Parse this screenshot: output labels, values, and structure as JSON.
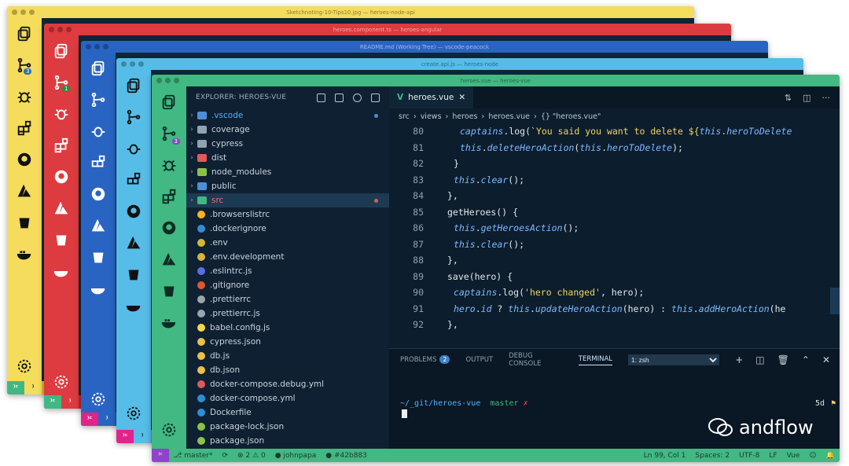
{
  "windows": [
    {
      "title": "Sketchnoting-10-Tips10.jpg — heroes-node-api",
      "color": "#f5dc5c",
      "status_color": "#d6be2e"
    },
    {
      "title": "heroes.component.ts — heroes-angular",
      "color": "#dd3b3f",
      "status_color": "#b22c30"
    },
    {
      "title": "README.md (Working Tree) — vscode-peacock",
      "color": "#2a64c2",
      "status_color": "#1d4f9e"
    },
    {
      "title": "create.api.js — heroes-node",
      "color": "#55bde8",
      "status_color": "#3ba2cf"
    },
    {
      "title": "heroes.vue — heroes-vue",
      "color": "#42b883",
      "status_color": "#2f9a6b"
    }
  ],
  "front": {
    "explorer_title": "EXPLORER: HEROES-VUE",
    "tree": [
      {
        "name": ".vscode",
        "folder": true,
        "color": "#4d8ed8",
        "mod": "#4d8ed8",
        "name_color": "#4db2ff"
      },
      {
        "name": "coverage",
        "folder": true,
        "color": "#8fa3b0"
      },
      {
        "name": "cypress",
        "folder": true,
        "color": "#8fa3b0"
      },
      {
        "name": "dist",
        "folder": true,
        "color": "#e05a5a"
      },
      {
        "name": "node_modules",
        "folder": true,
        "color": "#8bc34a"
      },
      {
        "name": "public",
        "folder": true,
        "color": "#4d8ed8"
      },
      {
        "name": "src",
        "folder": true,
        "color": "#41b883",
        "sel": true,
        "mod": "#e05a5a",
        "name_color": "#e07070"
      },
      {
        "name": ".browserslistrc",
        "folder": false,
        "color": "#f5b324"
      },
      {
        "name": ".dockerignore",
        "folder": false,
        "color": "#2f8ed6"
      },
      {
        "name": ".env",
        "folder": false,
        "color": "#d6b53b"
      },
      {
        "name": ".env.development",
        "folder": false,
        "color": "#d6b53b"
      },
      {
        "name": ".eslintrc.js",
        "folder": false,
        "color": "#5b6ee0"
      },
      {
        "name": ".gitignore",
        "folder": false,
        "color": "#e0572e"
      },
      {
        "name": ".prettierrc",
        "folder": false,
        "color": "#9aa5ad"
      },
      {
        "name": ".prettierrc.js",
        "folder": false,
        "color": "#9aa5ad"
      },
      {
        "name": "babel.config.js",
        "folder": false,
        "color": "#f5d742"
      },
      {
        "name": "cypress.json",
        "folder": false,
        "color": "#e8c04a"
      },
      {
        "name": "db.js",
        "folder": false,
        "color": "#e8c04a"
      },
      {
        "name": "db.json",
        "folder": false,
        "color": "#e8c04a"
      },
      {
        "name": "docker-compose.debug.yml",
        "folder": false,
        "color": "#e05a5a"
      },
      {
        "name": "docker-compose.yml",
        "folder": false,
        "color": "#2f8ed6"
      },
      {
        "name": "Dockerfile",
        "folder": false,
        "color": "#2f8ed6"
      },
      {
        "name": "package-lock.json",
        "folder": false,
        "color": "#8bc34a"
      },
      {
        "name": "package.json",
        "folder": false,
        "color": "#8bc34a"
      }
    ],
    "tab_label": "heroes.vue",
    "breadcrumb": [
      "src",
      "views",
      "heroes",
      "heroes.vue",
      "{} \"heroes.vue\""
    ],
    "code_lines": [
      {
        "n": "80",
        "indent": 4,
        "parts": [
          [
            "kw",
            "captains"
          ],
          [
            "fn",
            ".log("
          ],
          [
            "str",
            "`You said you want to delete ${"
          ],
          [
            "kw",
            "this"
          ],
          [
            "str",
            "."
          ],
          [
            "kw",
            "heroToDelete"
          ]
        ]
      },
      {
        "n": "81",
        "indent": 4,
        "parts": [
          [
            "kw",
            "this"
          ],
          [
            "fn",
            "."
          ],
          [
            "kw",
            "deleteHeroAction"
          ],
          [
            "fn",
            "("
          ],
          [
            "kw",
            "this"
          ],
          [
            "fn",
            "."
          ],
          [
            "kw",
            "heroToDelete"
          ],
          [
            "fn",
            ");"
          ]
        ]
      },
      {
        "n": "82",
        "indent": 3,
        "parts": [
          [
            "fn",
            "}"
          ]
        ]
      },
      {
        "n": "83",
        "indent": 3,
        "parts": [
          [
            "kw",
            "this"
          ],
          [
            "fn",
            "."
          ],
          [
            "kw",
            "clear"
          ],
          [
            "fn",
            "();"
          ]
        ]
      },
      {
        "n": "84",
        "indent": 2,
        "parts": [
          [
            "fn",
            "},"
          ]
        ]
      },
      {
        "n": "85",
        "indent": 2,
        "parts": [
          [
            "fn",
            "getHeroes() {"
          ]
        ]
      },
      {
        "n": "86",
        "indent": 3,
        "parts": [
          [
            "kw",
            "this"
          ],
          [
            "fn",
            "."
          ],
          [
            "kw",
            "getHeroesAction"
          ],
          [
            "fn",
            "();"
          ]
        ]
      },
      {
        "n": "87",
        "indent": 3,
        "parts": [
          [
            "kw",
            "this"
          ],
          [
            "fn",
            "."
          ],
          [
            "kw",
            "clear"
          ],
          [
            "fn",
            "();"
          ]
        ]
      },
      {
        "n": "88",
        "indent": 2,
        "parts": [
          [
            "fn",
            "},"
          ]
        ]
      },
      {
        "n": "89",
        "indent": 2,
        "parts": [
          [
            "fn",
            "save(hero) {"
          ]
        ]
      },
      {
        "n": "90",
        "indent": 3,
        "parts": [
          [
            "kw",
            "captains"
          ],
          [
            "fn",
            ".log("
          ],
          [
            "str",
            "'hero changed'"
          ],
          [
            "fn",
            ", hero);"
          ]
        ]
      },
      {
        "n": "91",
        "indent": 3,
        "parts": [
          [
            "kw",
            "hero"
          ],
          [
            "fn",
            "."
          ],
          [
            "kw",
            "id"
          ],
          [
            "fn",
            " ? "
          ],
          [
            "kw",
            "this"
          ],
          [
            "fn",
            "."
          ],
          [
            "kw",
            "updateHeroAction"
          ],
          [
            "fn",
            "(hero) : "
          ],
          [
            "kw",
            "this"
          ],
          [
            "fn",
            "."
          ],
          [
            "kw",
            "addHeroAction"
          ],
          [
            "fn",
            "(he"
          ]
        ]
      },
      {
        "n": "92",
        "indent": 2,
        "parts": [
          [
            "fn",
            "},"
          ]
        ]
      }
    ],
    "panel": {
      "problems": "PROBLEMS",
      "problems_count": "2",
      "output": "OUTPUT",
      "debug": "DEBUG CONSOLE",
      "terminal": "TERMINAL",
      "terminal_select": "1: zsh"
    },
    "terminal": {
      "cwd": "~/_git/heroes-vue",
      "branch": "master",
      "mark": "✗",
      "time": "5d"
    },
    "status": {
      "branch": "master*",
      "errors": "2",
      "warnings": "0",
      "user": "johnpapa",
      "commit": "#42b883",
      "position": "Ln 99, Col 1",
      "spaces": "Spaces: 2",
      "encoding": "UTF-8",
      "eol": "LF",
      "lang": "Vue"
    }
  },
  "scm_badges": [
    "3",
    "1",
    "3"
  ],
  "watermark": "andflow"
}
